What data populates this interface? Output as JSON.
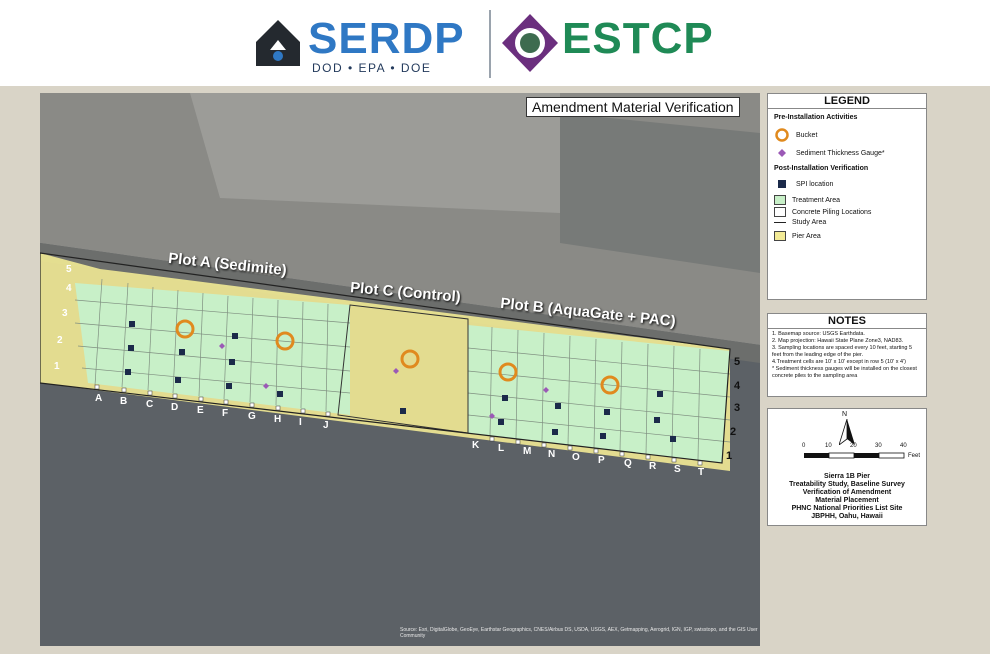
{
  "header": {
    "serdp_logo_text": "SERDP",
    "serdp_logo_subtitle": "DOD • EPA • DOE",
    "estcp_logo_text": "ESTCP"
  },
  "map": {
    "title": "Amendment Material Verification",
    "plot_labels": {
      "plot_a": "Plot A (Sedimite)",
      "plot_c": "Plot C (Control)",
      "plot_b": "Plot B (AquaGate + PAC)"
    },
    "row_labels_left": [
      "5",
      "4",
      "3",
      "2",
      "1"
    ],
    "row_labels_right": [
      "5",
      "4",
      "3",
      "2",
      "1"
    ],
    "column_labels_a": [
      "A",
      "B",
      "C",
      "D",
      "E",
      "F",
      "G",
      "H",
      "I",
      "J"
    ],
    "column_labels_b": [
      "K",
      "L",
      "M",
      "N",
      "O",
      "P",
      "Q",
      "R",
      "S",
      "T"
    ],
    "attribution": "Source: Esri, DigitalGlobe, GeoEye, Earthstar Geographics, CNES/Airbus DS, USDA, USGS, AEX, Getmapping, Aerogrid, IGN, IGP, swisstopo, and the GIS User Community"
  },
  "legend": {
    "title": "LEGEND",
    "pre_heading": "Pre-Installation Activities",
    "post_heading": "Post-Installation Verification",
    "items": {
      "bucket": "Bucket",
      "gauge": "Sediment Thickness Gauge*",
      "spi": "SPI location",
      "treatment": "Treatment Area",
      "piling": "Concrete Piling Locations",
      "study": "Study Area",
      "pier": "Pier Area"
    },
    "colors": {
      "treatment": "#c8f0c8",
      "pier": "#f2ea95",
      "bucket": "#e08a1e",
      "gauge": "#9b59b6",
      "spi": "#1b2a4a"
    }
  },
  "notes": {
    "title": "NOTES",
    "lines": [
      "1. Basemap source: USGS Earthdata.",
      "2. Map projection: Hawaii State Plane Zone3, NAD83.",
      "3. Sampling locations are spaced every 10 feet, starting 5 feet from the leading edge of the pier.",
      "4.Treatment cells are 10' x 10' except in row 5 (10' x 4')",
      "* Sediment thickness gauges will be installed on the closest concrete piles to the sampling area"
    ]
  },
  "info": {
    "north": "N",
    "scale_ticks": [
      "0",
      "10",
      "20",
      "30",
      "40"
    ],
    "scale_unit": "Feet",
    "title_lines": [
      "Sierra 1B Pier",
      "Treatability Study, Baseline Survey",
      "Verification of Amendment",
      "Material Placement",
      "PHNC National Priorities List Site",
      "JBPHH, Oahu, Hawaii"
    ]
  }
}
